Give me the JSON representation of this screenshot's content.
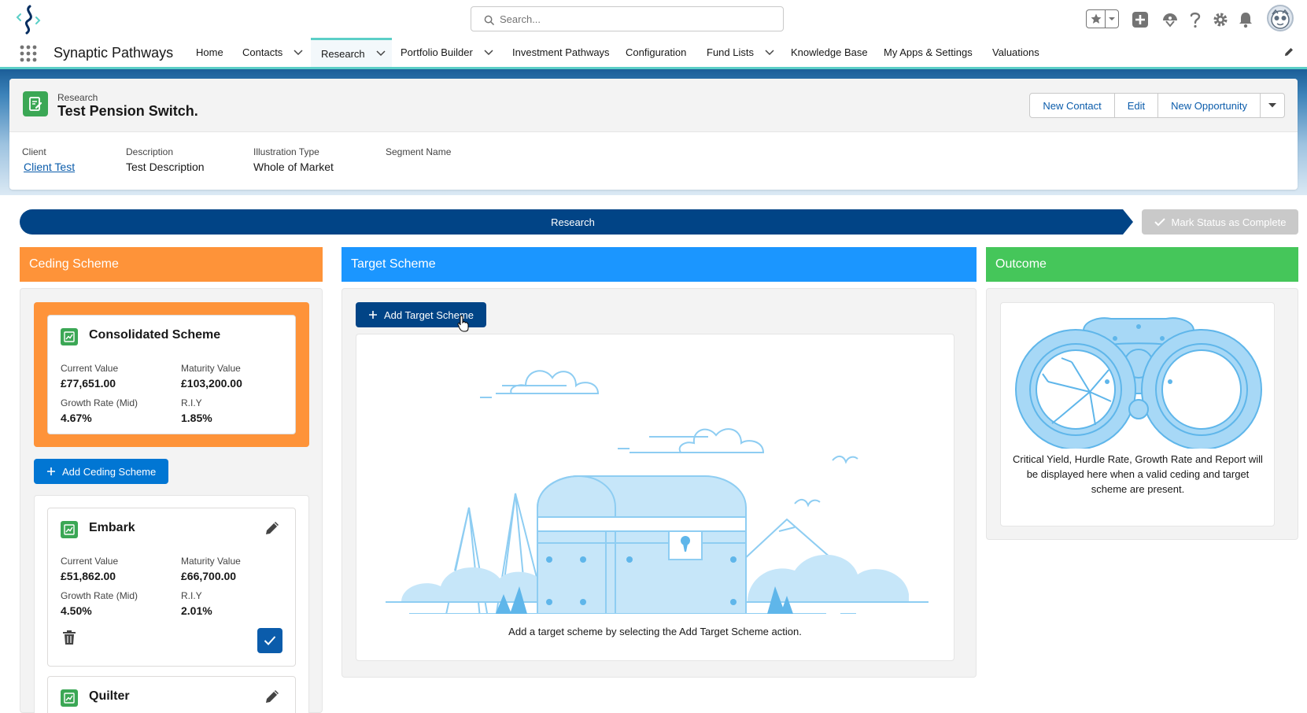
{
  "header": {
    "search_placeholder": "Search..."
  },
  "nav": {
    "app_name": "Synaptic Pathways",
    "items": [
      {
        "label": "Home"
      },
      {
        "label": "Contacts"
      },
      {
        "label": "Research"
      },
      {
        "label": "Portfolio Builder"
      },
      {
        "label": "Investment Pathways"
      },
      {
        "label": "Configuration"
      },
      {
        "label": "Fund Lists"
      },
      {
        "label": "Knowledge Base"
      },
      {
        "label": "My Apps & Settings"
      },
      {
        "label": "Valuations"
      }
    ]
  },
  "record": {
    "type": "Research",
    "title": "Test Pension Switch.",
    "actions": {
      "new_contact": "New Contact",
      "edit": "Edit",
      "new_opportunity": "New Opportunity"
    },
    "fields": [
      {
        "label": "Client",
        "value": "Client Test"
      },
      {
        "label": "Description",
        "value": "Test Description"
      },
      {
        "label": "Illustration Type",
        "value": "Whole of Market"
      },
      {
        "label": "Segment Name",
        "value": ""
      }
    ]
  },
  "path": {
    "current_stage": "Research",
    "mark_complete": "Mark Status as Complete"
  },
  "columns": {
    "ceding": {
      "title": "Ceding Scheme",
      "color": "#fe9339",
      "consolidated": {
        "name": "Consolidated Scheme",
        "current_value_label": "Current Value",
        "current_value": "£77,651.00",
        "maturity_value_label": "Maturity Value",
        "maturity_value": "£103,200.00",
        "growth_rate_label": "Growth Rate (Mid)",
        "growth_rate": "4.67%",
        "riy_label": "R.I.Y",
        "riy": "1.85%"
      },
      "add_button": "Add Ceding Scheme",
      "schemes": [
        {
          "name": "Embark",
          "current_value_label": "Current Value",
          "current_value": "£51,862.00",
          "maturity_value_label": "Maturity Value",
          "maturity_value": "£66,700.00",
          "growth_rate_label": "Growth Rate (Mid)",
          "growth_rate": "4.50%",
          "riy_label": "R.I.Y",
          "riy": "2.01%"
        },
        {
          "name": "Quilter"
        }
      ]
    },
    "target": {
      "title": "Target Scheme",
      "color": "#1b96ff",
      "add_button": "Add Target Scheme",
      "empty_text": "Add a target scheme by selecting the Add Target Scheme action."
    },
    "outcome": {
      "title": "Outcome",
      "color": "#45c65a",
      "empty_text": "Critical Yield, Hurdle Rate, Growth Rate and Report will be displayed here when a valid ceding and target scheme are present."
    }
  }
}
